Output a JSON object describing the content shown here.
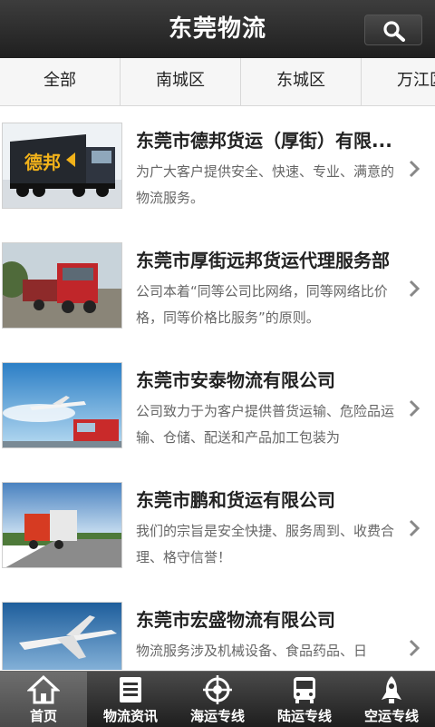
{
  "header": {
    "title": "东莞物流",
    "search_icon": "search-icon"
  },
  "tabs": [
    {
      "label": "全部"
    },
    {
      "label": "南城区"
    },
    {
      "label": "东城区"
    },
    {
      "label": "万江区"
    }
  ],
  "items": [
    {
      "title": "东莞市德邦货运（厚街）有限...",
      "desc": "为广大客户提供安全、快速、专业、满意的物流服务。",
      "thumb_text": "德邦"
    },
    {
      "title": "东莞市厚街远邦货运代理服务部",
      "desc": "公司本着“同等公司比网络，同等网络比价格，同等价格比服务”的原则。"
    },
    {
      "title": "东莞市安泰物流有限公司",
      "desc": "公司致力于为客户提供普货运输、危险品运输、仓储、配送和产品加工包装为"
    },
    {
      "title": "东莞市鹏和货运有限公司",
      "desc": "我们的宗旨是安全快捷、服务周到、收费合理、格守信誉！"
    },
    {
      "title": "东莞市宏盛物流有限公司",
      "desc": "物流服务涉及机械设备、食品药品、日"
    }
  ],
  "bottom_nav": [
    {
      "label": "首页",
      "icon": "home-icon",
      "active": true
    },
    {
      "label": "物流资讯",
      "icon": "news-icon",
      "active": false
    },
    {
      "label": "海运专线",
      "icon": "sea-route-icon",
      "active": false
    },
    {
      "label": "陆运专线",
      "icon": "bus-icon",
      "active": false
    },
    {
      "label": "空运专线",
      "icon": "rocket-icon",
      "active": false
    }
  ],
  "colors": {
    "topbar": "#2b2b2b",
    "tabbar": "#f6f6f6",
    "bottombar": "#2e2e2e",
    "active_tab": "#5a5a5a"
  }
}
